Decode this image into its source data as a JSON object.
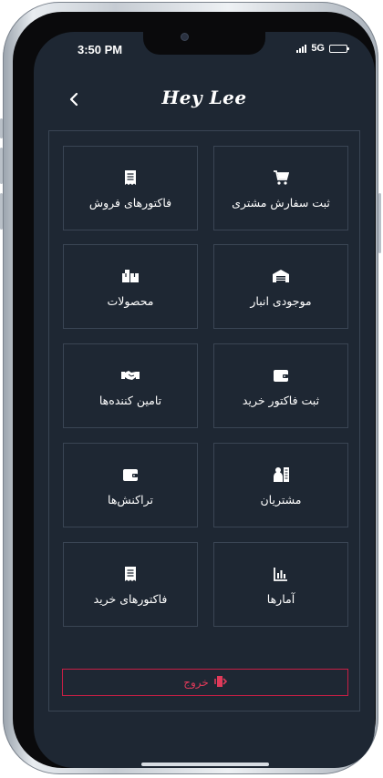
{
  "status": {
    "time": "3:50 PM",
    "network": "5G",
    "battery_level": 1.0
  },
  "header": {
    "title": "Hey Lee",
    "back_icon": "chevron-left-icon"
  },
  "menu": [
    {
      "id": "register-customer-order",
      "label": "ثبت سفارش مشتری",
      "icon": "cart-icon"
    },
    {
      "id": "sales-invoices",
      "label": "فاکتورهای فروش",
      "icon": "receipt-icon"
    },
    {
      "id": "warehouse-stock",
      "label": "موجودی انبار",
      "icon": "warehouse-icon"
    },
    {
      "id": "products",
      "label": "محصولات",
      "icon": "boxes-icon"
    },
    {
      "id": "register-purchase-invoice",
      "label": "ثبت فاکتور خرید",
      "icon": "wallet-icon"
    },
    {
      "id": "suppliers",
      "label": "تامین کننده‌ها",
      "icon": "handshake-icon"
    },
    {
      "id": "customers",
      "label": "مشتریان",
      "icon": "people-icon"
    },
    {
      "id": "transactions",
      "label": "تراکنش‌ها",
      "icon": "wallet-icon"
    },
    {
      "id": "statistics",
      "label": "آمارها",
      "icon": "bar-chart-icon"
    },
    {
      "id": "purchase-invoices",
      "label": "فاکتورهای خرید",
      "icon": "receipt-icon"
    }
  ],
  "logout": {
    "label": "خروج",
    "icon": "exit-icon"
  },
  "colors": {
    "background": "#1e2733",
    "border": "#3a4554",
    "logout_border": "#c81e45",
    "logout_text": "#e03a5a"
  }
}
